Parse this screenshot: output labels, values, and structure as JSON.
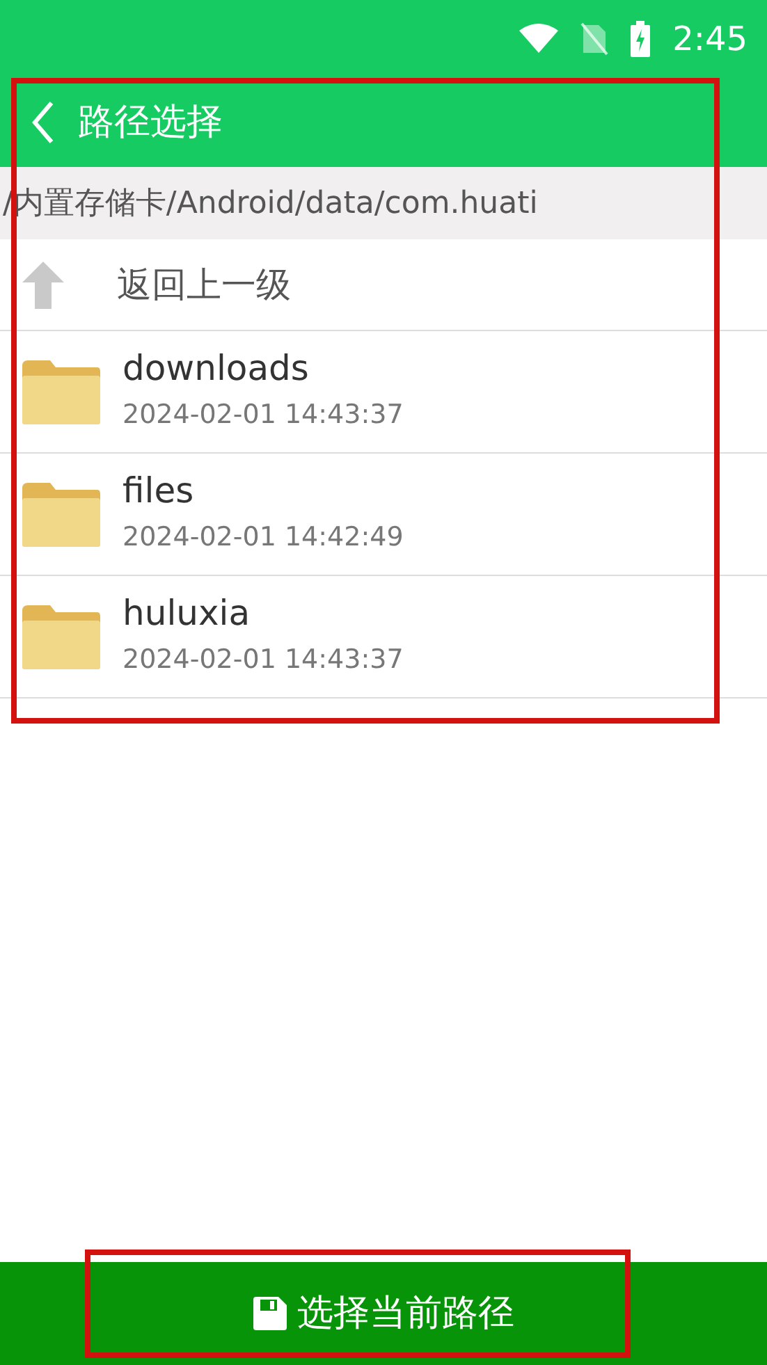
{
  "status_bar": {
    "time": "2:45"
  },
  "header": {
    "title": "路径选择"
  },
  "path_bar": {
    "path": "/内置存储卡/Android/data/com.huati"
  },
  "up_item": {
    "label": "返回上一级"
  },
  "folders": [
    {
      "name": "downloads",
      "date": "2024-02-01 14:43:37"
    },
    {
      "name": "files",
      "date": "2024-02-01 14:42:49"
    },
    {
      "name": "huluxia",
      "date": "2024-02-01 14:43:37"
    }
  ],
  "action_button": {
    "label": "选择当前路径"
  }
}
